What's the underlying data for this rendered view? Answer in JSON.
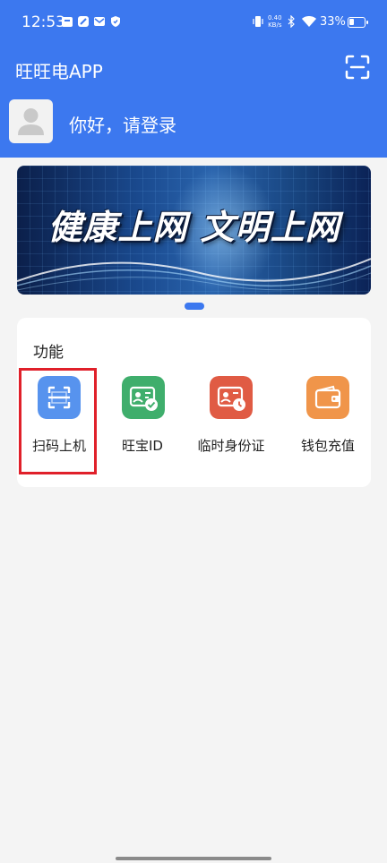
{
  "status_bar": {
    "time": "12:53",
    "net_speed_value": "0.40",
    "net_speed_unit": "KB/s",
    "battery_percent": "33%",
    "battery_level": 0.33
  },
  "header": {
    "app_title": "旺旺电APP",
    "login_prompt": "你好，请登录"
  },
  "banner": {
    "text": "健康上网 文明上网"
  },
  "functions": {
    "section_title": "功能",
    "items": [
      {
        "label": "扫码上机",
        "icon": "scan-icon",
        "color": "#5793ee"
      },
      {
        "label": "旺宝ID",
        "icon": "id-card-check-icon",
        "color": "#3fae6c"
      },
      {
        "label": "临时身份证",
        "icon": "temp-id-card-icon",
        "color": "#e05b44"
      },
      {
        "label": "钱包充值",
        "icon": "wallet-icon",
        "color": "#f0954a"
      }
    ]
  },
  "colors": {
    "primary": "#3c78ef",
    "highlight": "#e0202a",
    "background": "#f4f4f4"
  }
}
